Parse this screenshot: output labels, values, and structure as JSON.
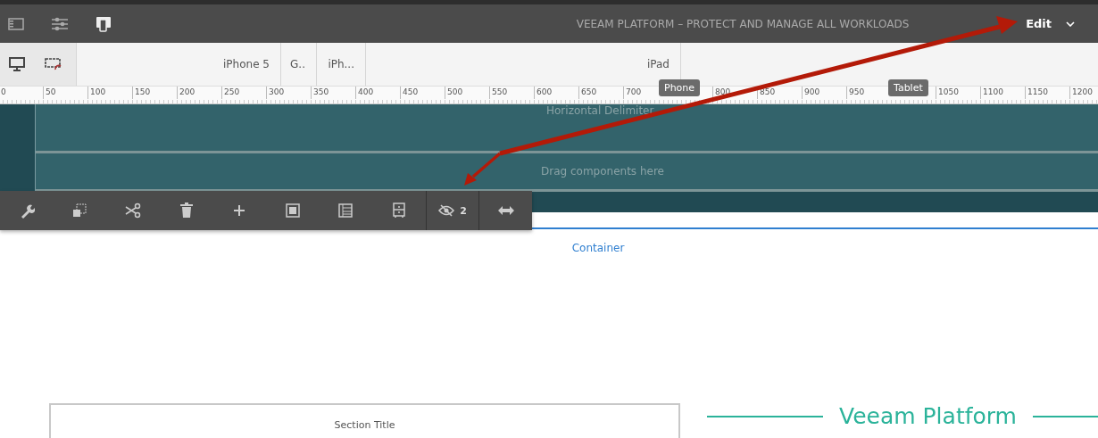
{
  "header": {
    "title": "VEEAM PLATFORM – PROTECT AND MANAGE ALL WORKLOADS",
    "mode": "Edit"
  },
  "device_bar": {
    "devices": [
      {
        "label": "iPhone 5",
        "kind": "wide"
      },
      {
        "label": "G..",
        "kind": "narrow"
      },
      {
        "label": "iPh...",
        "kind": "mid"
      },
      {
        "label": "iPad",
        "kind": "large"
      }
    ]
  },
  "ruler": {
    "labels": [
      "0",
      "50",
      "100",
      "150",
      "200",
      "250",
      "300",
      "350",
      "400",
      "450",
      "500",
      "550",
      "600",
      "650",
      "700",
      "800",
      "850",
      "900",
      "950",
      "1050",
      "1100",
      "1150",
      "1200"
    ]
  },
  "tooltips": [
    {
      "label": "Phone",
      "kind": "phone"
    },
    {
      "label": "Tablet",
      "kind": "tablet"
    }
  ],
  "canvas": {
    "delimiter_label": "Horizontal Delimiter",
    "drop_hint": "Drag components here"
  },
  "toolbar": {
    "hidden_count": "2"
  },
  "container_label": "Container",
  "section_title": "Section Title",
  "brand_heading": "Veeam Platform"
}
